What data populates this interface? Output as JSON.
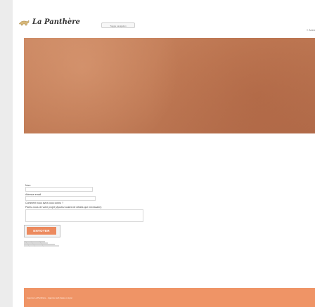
{
  "header": {
    "brand": "La Panthère",
    "logo_icon": "panther-icon",
    "nav_toggle_label": "Toggle navigation",
    "home_link": "« Accu"
  },
  "hero": {
    "color": "#c07a55"
  },
  "form": {
    "name_label": "Nom",
    "email_label": "Adresse email",
    "source_label": "Comment nous avez-vous connu ?",
    "message_label": "Parlez-nous de votre projet (Ajoutez autant de détails que nécessaire)",
    "send_label": "ENVOYER",
    "accent": "#ec8a5e"
  },
  "footer": {
    "text": "Agence La Panthère - Agence web basée à Lyon",
    "color": "#ef9466"
  }
}
